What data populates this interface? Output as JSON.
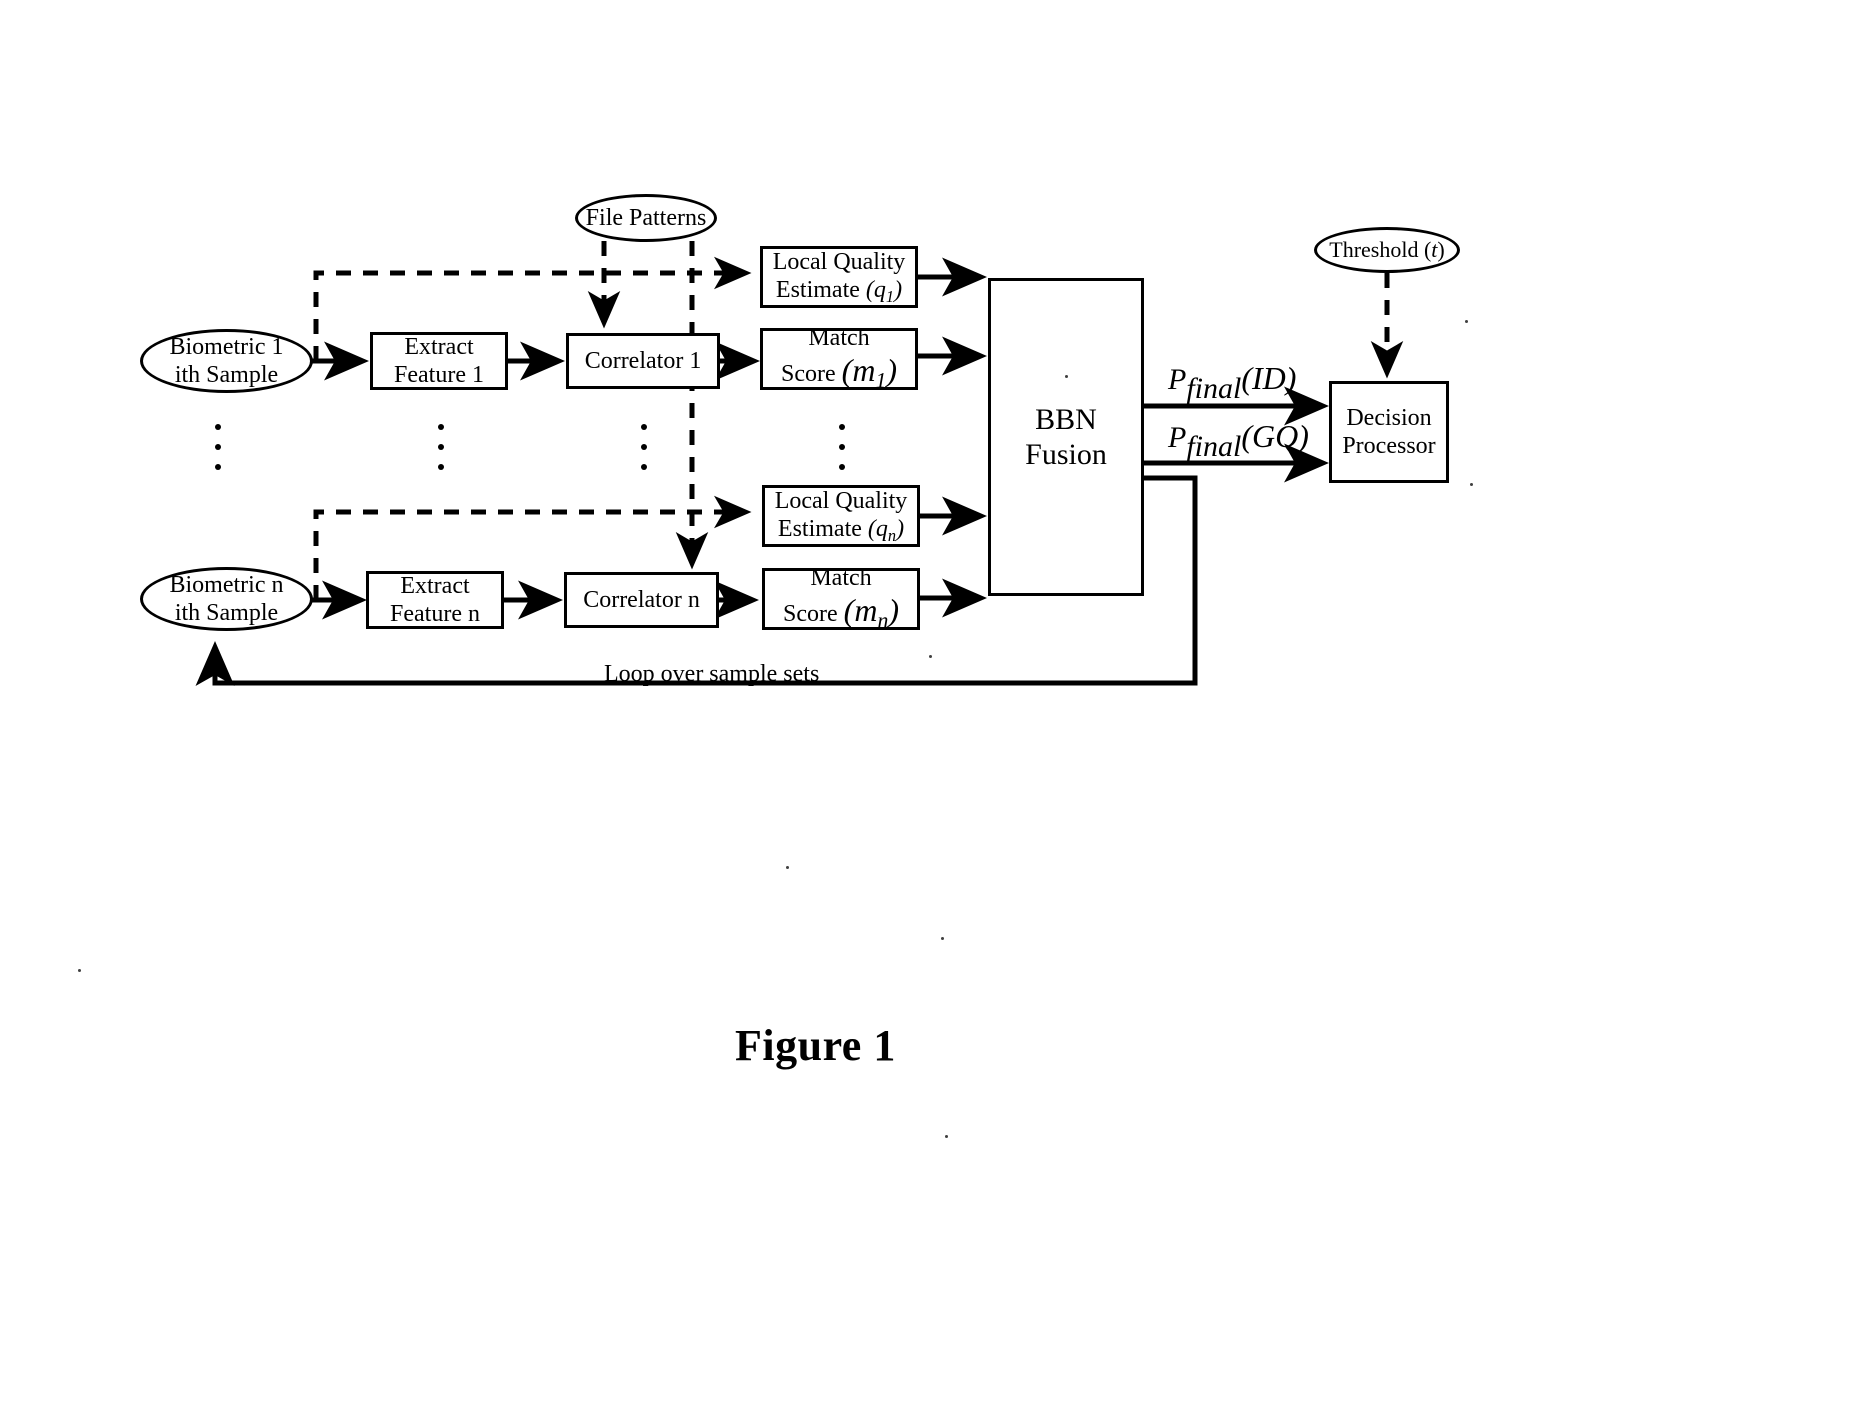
{
  "figure": {
    "caption": "Figure 1"
  },
  "nodes": {
    "file_patterns": {
      "label": "File Patterns"
    },
    "threshold": {
      "label_main": "Threshold (",
      "label_var": "t",
      "label_end": ")"
    },
    "biometric1": {
      "line1": "Biometric 1",
      "line2": "ith Sample"
    },
    "biometric_n": {
      "line1": "Biometric n",
      "line2": "ith Sample"
    },
    "extract1": {
      "line1": "Extract",
      "line2": "Feature 1"
    },
    "extract_n": {
      "line1": "Extract",
      "line2": "Feature n"
    },
    "correlator1": {
      "label": "Correlator 1"
    },
    "correlator_n": {
      "label": "Correlator n"
    },
    "lqe1": {
      "line1": "Local Quality",
      "line2": "Estimate ",
      "var": "q",
      "sub": "1"
    },
    "lqe_n": {
      "line1": "Local Quality",
      "line2": "Estimate ",
      "var": "q",
      "sub": "n"
    },
    "match1": {
      "line1": "Match",
      "line2": "Score ",
      "var": "m",
      "sub": "1"
    },
    "match_n": {
      "line1": "Match",
      "line2": "Score ",
      "var": "m",
      "sub": "n"
    },
    "bbn": {
      "line1": "BBN",
      "line2": "Fusion"
    },
    "decision": {
      "line1": "Decision",
      "line2": "Processor"
    }
  },
  "edge_labels": {
    "p_id": {
      "p": "P",
      "sub": "final",
      "arg": "(ID)"
    },
    "p_gq": {
      "p": "P",
      "sub": "final",
      "arg": "(GQ)"
    },
    "loop": "Loop over sample sets"
  },
  "colors": {
    "ink": "#000000",
    "paper": "#ffffff"
  }
}
